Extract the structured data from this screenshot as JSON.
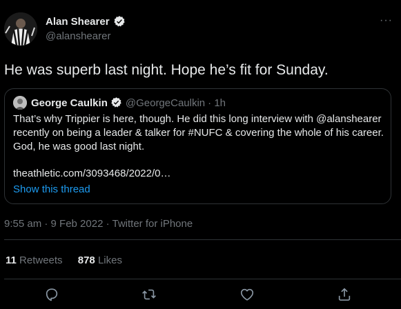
{
  "tweet": {
    "author_name": "Alan Shearer",
    "author_handle": "@alanshearer",
    "text": "He was superb last night. Hope he’s fit for Sunday.",
    "timestamp": "9:55 am · 9 Feb 2022 · Twitter for iPhone",
    "more_glyph": "···"
  },
  "quote": {
    "author_name": "George Caulkin",
    "author_handle": "@GeorgeCaulkin",
    "time": "· 1h",
    "lines": [
      "That’s why Trippier is here, though. He did this long interview with @alanshearer",
      "recently on being a leader & talker for #NUFC & covering the whole of his career.",
      "God, he was good last night."
    ],
    "link": "theathletic.com/3093468/2022/0…",
    "show_thread": "Show this thread"
  },
  "stats": {
    "retweets_count": "11",
    "retweets_label": "Retweets",
    "likes_count": "878",
    "likes_label": "Likes"
  },
  "actions": [
    "reply-icon",
    "retweet-icon",
    "like-icon",
    "share-icon"
  ],
  "colors": {
    "background": "#000000",
    "text": "#e7e9ea",
    "secondary": "#71767b",
    "accent": "#1d9bf0",
    "border": "#2f3336"
  }
}
